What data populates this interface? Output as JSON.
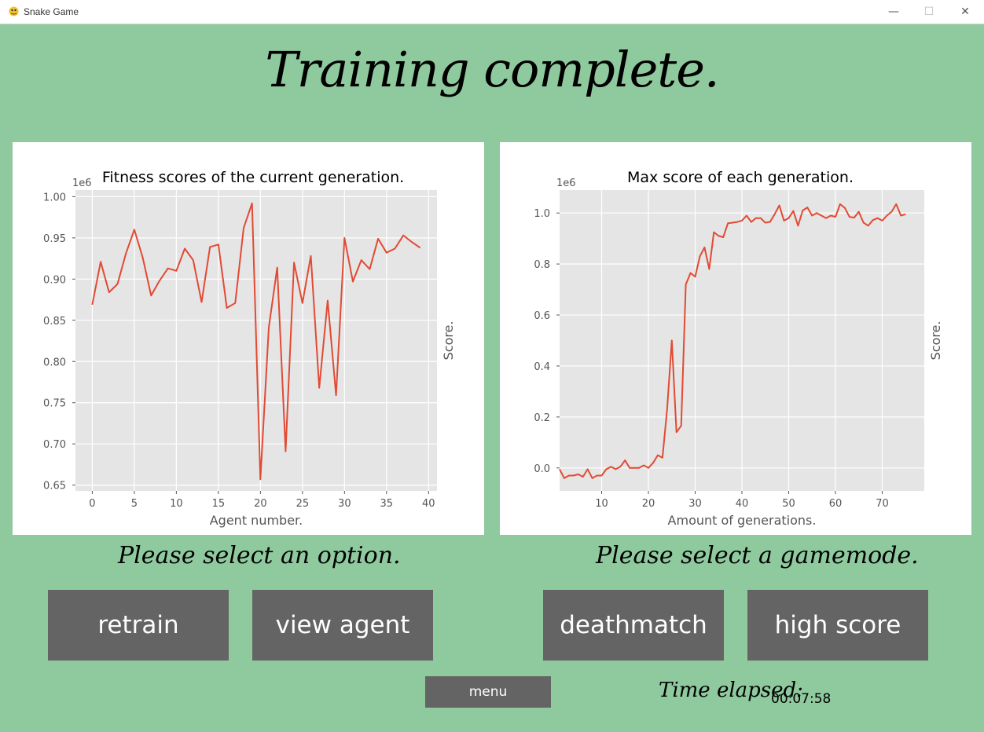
{
  "window": {
    "title": "Snake Game",
    "minimize": "—",
    "maximize": "☐",
    "close": "✕"
  },
  "headline": "Training complete.",
  "prompts": {
    "option": "Please select an option.",
    "gamemode": "Please select a gamemode."
  },
  "buttons": {
    "retrain": "retrain",
    "view_agent": "view agent",
    "deathmatch": "deathmatch",
    "high_score": "high score",
    "menu": "menu"
  },
  "timer": {
    "label": "Time elapsed:",
    "value": "00:07:58"
  },
  "colors": {
    "background": "#8fca9e",
    "button": "#646464",
    "line": "#e24a33",
    "plot_bg": "#e5e5e5"
  },
  "chart_data": [
    {
      "type": "line",
      "title": "Fitness scores of the current generation.",
      "xlabel": "Agent number.",
      "ylabel": "Score.",
      "scale_label": "1e6",
      "xlim": [
        -2,
        41
      ],
      "ylim": [
        0.643,
        1.008
      ],
      "xticks": [
        0,
        5,
        10,
        15,
        20,
        25,
        30,
        35,
        40
      ],
      "yticks": [
        0.65,
        0.7,
        0.75,
        0.8,
        0.85,
        0.9,
        0.95,
        1.0
      ],
      "ytick_labels": [
        "0.65",
        "0.70",
        "0.75",
        "0.80",
        "0.85",
        "0.90",
        "0.95",
        "1.00"
      ],
      "x": [
        0,
        1,
        2,
        3,
        4,
        5,
        6,
        7,
        8,
        9,
        10,
        11,
        12,
        13,
        14,
        15,
        16,
        17,
        18,
        19,
        20,
        21,
        22,
        23,
        24,
        25,
        26,
        27,
        28,
        29,
        30,
        31,
        32,
        33,
        34,
        35,
        36,
        37,
        38,
        39
      ],
      "y": [
        0.869,
        0.921,
        0.884,
        0.894,
        0.931,
        0.96,
        0.926,
        0.88,
        0.898,
        0.913,
        0.91,
        0.937,
        0.923,
        0.872,
        0.939,
        0.942,
        0.865,
        0.871,
        0.962,
        0.992,
        0.657,
        0.841,
        0.914,
        0.691,
        0.92,
        0.871,
        0.928,
        0.768,
        0.874,
        0.759,
        0.95,
        0.897,
        0.923,
        0.912,
        0.949,
        0.932,
        0.937,
        0.953,
        0.945,
        0.938
      ]
    },
    {
      "type": "line",
      "title": "Max score of each generation.",
      "xlabel": "Amount of generations.",
      "ylabel": "Score.",
      "scale_label": "1e6",
      "xlim": [
        1,
        79
      ],
      "ylim": [
        -0.09,
        1.09
      ],
      "xticks": [
        10,
        20,
        30,
        40,
        50,
        60,
        70
      ],
      "yticks": [
        0.0,
        0.2,
        0.4,
        0.6,
        0.8,
        1.0
      ],
      "ytick_labels": [
        "0.0",
        "0.2",
        "0.4",
        "0.6",
        "0.8",
        "1.0"
      ],
      "x": [
        1,
        2,
        3,
        4,
        5,
        6,
        7,
        8,
        9,
        10,
        11,
        12,
        13,
        14,
        15,
        16,
        17,
        18,
        19,
        20,
        21,
        22,
        23,
        24,
        25,
        26,
        27,
        28,
        29,
        30,
        31,
        32,
        33,
        34,
        35,
        36,
        37,
        38,
        39,
        40,
        41,
        42,
        43,
        44,
        45,
        46,
        47,
        48,
        49,
        50,
        51,
        52,
        53,
        54,
        55,
        56,
        57,
        58,
        59,
        60,
        61,
        62,
        63,
        64,
        65,
        66,
        67,
        68,
        69,
        70,
        71,
        72,
        73,
        74,
        75
      ],
      "y": [
        -0.005,
        -0.04,
        -0.03,
        -0.03,
        -0.025,
        -0.035,
        -0.005,
        -0.04,
        -0.03,
        -0.03,
        -0.005,
        0.005,
        -0.005,
        0.005,
        0.03,
        0.0,
        0.0,
        0.0,
        0.01,
        0.0,
        0.02,
        0.05,
        0.04,
        0.23,
        0.5,
        0.14,
        0.165,
        0.72,
        0.765,
        0.75,
        0.83,
        0.865,
        0.78,
        0.925,
        0.91,
        0.905,
        0.96,
        0.962,
        0.965,
        0.97,
        0.99,
        0.965,
        0.98,
        0.98,
        0.962,
        0.965,
        0.995,
        1.03,
        0.97,
        0.98,
        1.008,
        0.95,
        1.01,
        1.022,
        0.99,
        1.0,
        0.99,
        0.98,
        0.99,
        0.985,
        1.035,
        1.02,
        0.985,
        0.982,
        1.005,
        0.962,
        0.95,
        0.972,
        0.98,
        0.97,
        0.99,
        1.005,
        1.035,
        0.99,
        0.995
      ]
    }
  ]
}
